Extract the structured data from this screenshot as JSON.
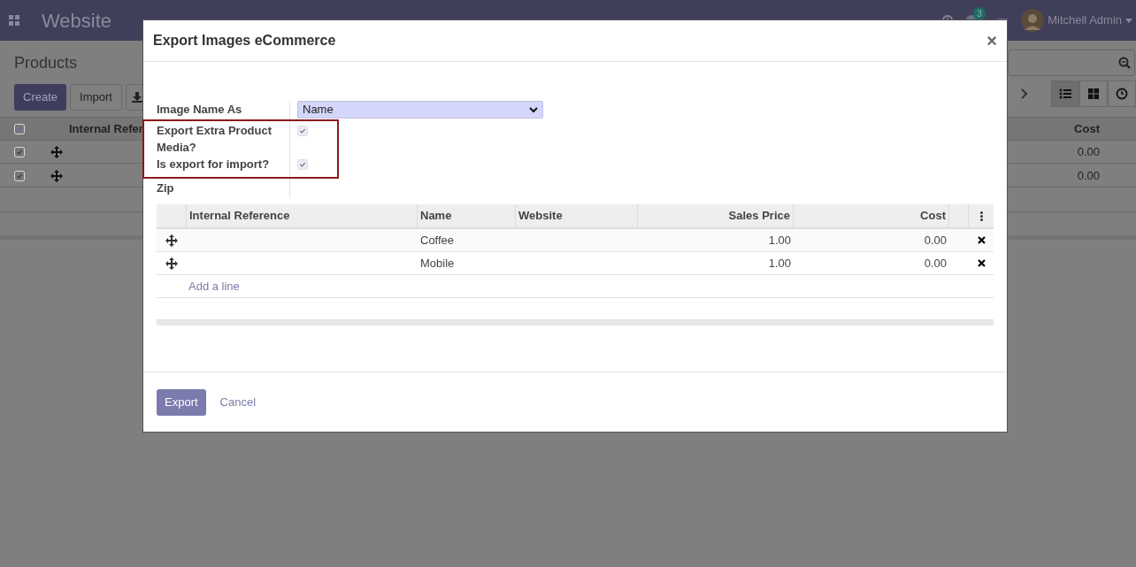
{
  "navbar": {
    "app_name": "Website",
    "messages_badge": "3",
    "user": "Mitchell Admin"
  },
  "page": {
    "title": "Products",
    "buttons": [
      "Create",
      "Import"
    ],
    "views": [
      {
        "kind": "list",
        "selected": true
      },
      {
        "kind": "kanban",
        "selected": false
      },
      {
        "kind": "activity",
        "selected": false
      }
    ],
    "table": {
      "columns": [
        "Internal Refer",
        "Cost"
      ],
      "rows": [
        {
          "checked": true,
          "cost": "0.00"
        },
        {
          "checked": true,
          "cost": "0.00"
        }
      ]
    }
  },
  "dialog": {
    "title": "Export Images eCommerce",
    "close": "×",
    "fields": [
      {
        "kind": "select",
        "label": "Image Name As",
        "value": "Name"
      },
      {
        "kind": "checkbox",
        "label": "Export Extra Product Media?",
        "checked": true
      },
      {
        "kind": "checkbox",
        "label": "Is export for import?",
        "checked": true
      },
      {
        "kind": "empty",
        "label": "Zip"
      }
    ],
    "lines": {
      "columns": [
        "Internal Reference",
        "Name",
        "Website",
        "Sales Price",
        "Cost"
      ],
      "rows": [
        {
          "name": "Coffee",
          "sales_price": "1.00",
          "cost": "0.00"
        },
        {
          "name": "Mobile",
          "sales_price": "1.00",
          "cost": "0.00"
        }
      ],
      "add_line": "Add a line"
    },
    "buttons": [
      {
        "kind": "primary",
        "label": "Export"
      },
      {
        "kind": "link",
        "label": "Cancel"
      }
    ]
  }
}
